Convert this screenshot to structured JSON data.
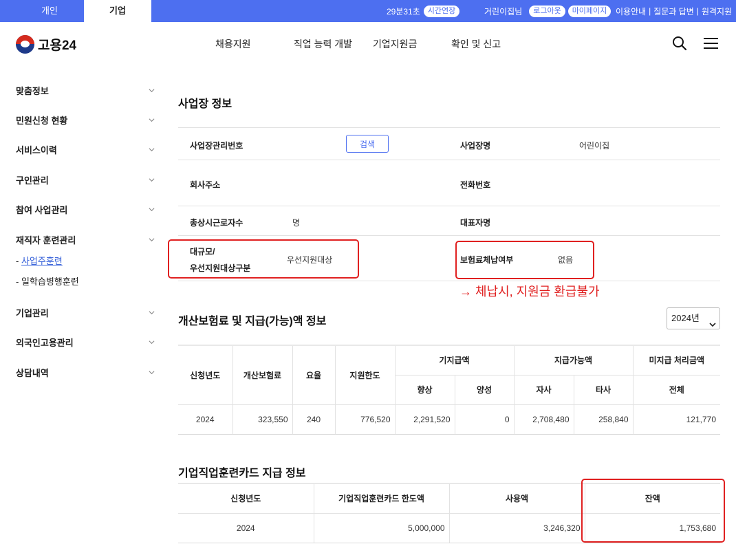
{
  "topbar": {
    "tab_personal": "개인",
    "tab_company": "기업",
    "session_time": "29분31초",
    "extend_label": "시간연장",
    "user_name": "거린이집님",
    "logout_label": "로그아웃",
    "mypage_label": "마이페이지",
    "guide_label": "이용안내",
    "qna_label": "질문과 답변",
    "remote_label": "원격지원"
  },
  "header": {
    "logo_text": "고용24",
    "menu": [
      "채용지원",
      "직업 능력 개발",
      "기업지원금",
      "확인 및 신고"
    ]
  },
  "sidebar": {
    "items": [
      "맞춤정보",
      "민원신청 현황",
      "서비스이력",
      "구인관리",
      "참여 사업관리",
      "재직자 훈련관리",
      "기업관리",
      "외국인고용관리",
      "상담내역"
    ],
    "sub_items": [
      "사업주훈련",
      "일학습병행훈련"
    ],
    "sub_prefix": "- "
  },
  "workplace": {
    "title": "사업장 정보",
    "mgmt_no_label": "사업장관리번호",
    "search_label": "검색",
    "name_label": "사업장명",
    "name_value": "어린이집",
    "address_label": "회사주소",
    "phone_label": "전화번호",
    "workers_label": "총상시근로자수",
    "workers_unit": "명",
    "ceo_label": "대표자명",
    "scale_label_1": "대규모/",
    "scale_label_2": "우선지원대상구분",
    "scale_value": "우선지원대상",
    "arrears_label": "보험료체납여부",
    "arrears_value": "없음",
    "note": "→ 체납시, 지원금 환급불가"
  },
  "insurance": {
    "title": "개산보험료 및 지급(가능)액 정보",
    "year_select": "2024년",
    "headers": {
      "year": "신청년도",
      "premium": "개산보험료",
      "rate": "요율",
      "limit": "지원한도",
      "paid": "기지급액",
      "paid_a": "향상",
      "paid_b": "양성",
      "payable": "지급가능액",
      "payable_a": "자사",
      "payable_b": "타사",
      "unpaid": "미지급 처리금액",
      "unpaid_all": "전체"
    },
    "rows": [
      [
        "2024",
        "323,550",
        "240",
        "776,520",
        "2,291,520",
        "0",
        "2,708,480",
        "258,840",
        "121,770"
      ]
    ]
  },
  "card": {
    "title": "기업직업훈련카드 지급 정보",
    "headers": [
      "신청년도",
      "기업직업훈련카드 한도액",
      "사용액",
      "잔액"
    ],
    "rows": [
      [
        "2024",
        "5,000,000",
        "3,246,320",
        "1,753,680"
      ]
    ]
  },
  "colors": {
    "brand_blue": "#4d6ff0",
    "highlight_red": "#e02020"
  }
}
